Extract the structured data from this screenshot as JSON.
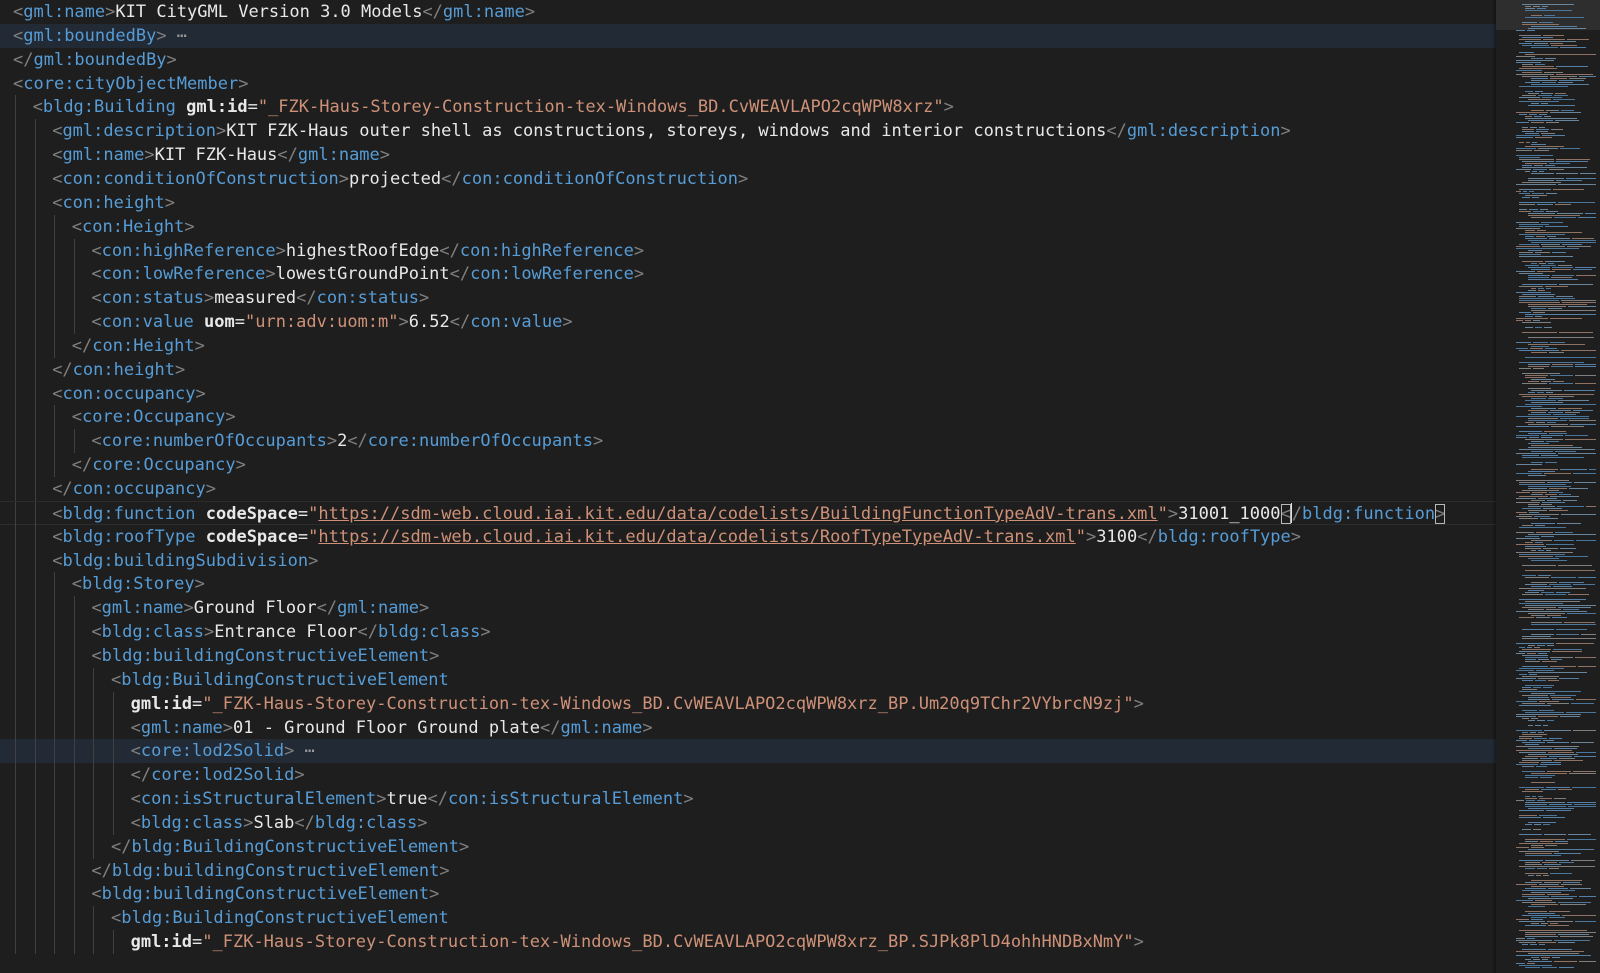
{
  "editor": {
    "language": "xml",
    "fold_ellipsis": "⋯",
    "lines": [
      {
        "indent": 0,
        "tokens": [
          [
            "b",
            "<"
          ],
          [
            "tag",
            "gml:name"
          ],
          [
            "b",
            ">"
          ],
          [
            "text",
            "KIT CityGML Version 3.0 Models"
          ],
          [
            "b",
            "</"
          ],
          [
            "tag",
            "gml:name"
          ],
          [
            "b",
            ">"
          ]
        ]
      },
      {
        "indent": 0,
        "folded": true,
        "highlight": "fold",
        "tokens": [
          [
            "b",
            "<"
          ],
          [
            "tag",
            "gml:boundedBy"
          ],
          [
            "b",
            ">"
          ]
        ]
      },
      {
        "indent": 0,
        "tokens": [
          [
            "b",
            "</"
          ],
          [
            "tag",
            "gml:boundedBy"
          ],
          [
            "b",
            ">"
          ]
        ]
      },
      {
        "indent": 0,
        "tokens": [
          [
            "b",
            "<"
          ],
          [
            "tag",
            "core:cityObjectMember"
          ],
          [
            "b",
            ">"
          ]
        ]
      },
      {
        "indent": 1,
        "tokens": [
          [
            "b",
            "<"
          ],
          [
            "tag",
            "bldg:Building"
          ],
          [
            "sp",
            " "
          ],
          [
            "attr",
            "gml:id"
          ],
          [
            "text",
            "="
          ],
          [
            "str",
            "\"_FZK-Haus-Storey-Construction-tex-Windows_BD.CvWEAVLAPO2cqWPW8xrz\""
          ],
          [
            "b",
            ">"
          ]
        ]
      },
      {
        "indent": 2,
        "tokens": [
          [
            "b",
            "<"
          ],
          [
            "tag",
            "gml:description"
          ],
          [
            "b",
            ">"
          ],
          [
            "text",
            "KIT FZK-Haus outer shell as constructions, storeys, windows and interior constructions"
          ],
          [
            "b",
            "</"
          ],
          [
            "tag",
            "gml:description"
          ],
          [
            "b",
            ">"
          ]
        ]
      },
      {
        "indent": 2,
        "tokens": [
          [
            "b",
            "<"
          ],
          [
            "tag",
            "gml:name"
          ],
          [
            "b",
            ">"
          ],
          [
            "text",
            "KIT FZK-Haus"
          ],
          [
            "b",
            "</"
          ],
          [
            "tag",
            "gml:name"
          ],
          [
            "b",
            ">"
          ]
        ]
      },
      {
        "indent": 2,
        "tokens": [
          [
            "b",
            "<"
          ],
          [
            "tag",
            "con:conditionOfConstruction"
          ],
          [
            "b",
            ">"
          ],
          [
            "text",
            "projected"
          ],
          [
            "b",
            "</"
          ],
          [
            "tag",
            "con:conditionOfConstruction"
          ],
          [
            "b",
            ">"
          ]
        ]
      },
      {
        "indent": 2,
        "tokens": [
          [
            "b",
            "<"
          ],
          [
            "tag",
            "con:height"
          ],
          [
            "b",
            ">"
          ]
        ]
      },
      {
        "indent": 3,
        "tokens": [
          [
            "b",
            "<"
          ],
          [
            "tag",
            "con:Height"
          ],
          [
            "b",
            ">"
          ]
        ]
      },
      {
        "indent": 4,
        "tokens": [
          [
            "b",
            "<"
          ],
          [
            "tag",
            "con:highReference"
          ],
          [
            "b",
            ">"
          ],
          [
            "text",
            "highestRoofEdge"
          ],
          [
            "b",
            "</"
          ],
          [
            "tag",
            "con:highReference"
          ],
          [
            "b",
            ">"
          ]
        ]
      },
      {
        "indent": 4,
        "tokens": [
          [
            "b",
            "<"
          ],
          [
            "tag",
            "con:lowReference"
          ],
          [
            "b",
            ">"
          ],
          [
            "text",
            "lowestGroundPoint"
          ],
          [
            "b",
            "</"
          ],
          [
            "tag",
            "con:lowReference"
          ],
          [
            "b",
            ">"
          ]
        ]
      },
      {
        "indent": 4,
        "tokens": [
          [
            "b",
            "<"
          ],
          [
            "tag",
            "con:status"
          ],
          [
            "b",
            ">"
          ],
          [
            "text",
            "measured"
          ],
          [
            "b",
            "</"
          ],
          [
            "tag",
            "con:status"
          ],
          [
            "b",
            ">"
          ]
        ]
      },
      {
        "indent": 4,
        "tokens": [
          [
            "b",
            "<"
          ],
          [
            "tag",
            "con:value"
          ],
          [
            "sp",
            " "
          ],
          [
            "attr",
            "uom"
          ],
          [
            "text",
            "="
          ],
          [
            "str",
            "\"urn:adv:uom:m\""
          ],
          [
            "b",
            ">"
          ],
          [
            "text",
            "6.52"
          ],
          [
            "b",
            "</"
          ],
          [
            "tag",
            "con:value"
          ],
          [
            "b",
            ">"
          ]
        ]
      },
      {
        "indent": 3,
        "tokens": [
          [
            "b",
            "</"
          ],
          [
            "tag",
            "con:Height"
          ],
          [
            "b",
            ">"
          ]
        ]
      },
      {
        "indent": 2,
        "tokens": [
          [
            "b",
            "</"
          ],
          [
            "tag",
            "con:height"
          ],
          [
            "b",
            ">"
          ]
        ]
      },
      {
        "indent": 2,
        "tokens": [
          [
            "b",
            "<"
          ],
          [
            "tag",
            "con:occupancy"
          ],
          [
            "b",
            ">"
          ]
        ]
      },
      {
        "indent": 3,
        "tokens": [
          [
            "b",
            "<"
          ],
          [
            "tag",
            "core:Occupancy"
          ],
          [
            "b",
            ">"
          ]
        ]
      },
      {
        "indent": 4,
        "tokens": [
          [
            "b",
            "<"
          ],
          [
            "tag",
            "core:numberOfOccupants"
          ],
          [
            "b",
            ">"
          ],
          [
            "text",
            "2"
          ],
          [
            "b",
            "</"
          ],
          [
            "tag",
            "core:numberOfOccupants"
          ],
          [
            "b",
            ">"
          ]
        ]
      },
      {
        "indent": 3,
        "tokens": [
          [
            "b",
            "</"
          ],
          [
            "tag",
            "core:Occupancy"
          ],
          [
            "b",
            ">"
          ]
        ]
      },
      {
        "indent": 2,
        "tokens": [
          [
            "b",
            "</"
          ],
          [
            "tag",
            "con:occupancy"
          ],
          [
            "b",
            ">"
          ]
        ]
      },
      {
        "indent": 2,
        "highlight": "cursor",
        "tokens": [
          [
            "b",
            "<"
          ],
          [
            "tag",
            "bldg:function"
          ],
          [
            "sp",
            " "
          ],
          [
            "attr",
            "codeSpace"
          ],
          [
            "text",
            "="
          ],
          [
            "str",
            "\""
          ],
          [
            "url",
            "https://sdm-web.cloud.iai.kit.edu/data/codelists/BuildingFunctionTypeAdV-trans.xml"
          ],
          [
            "str",
            "\""
          ],
          [
            "b",
            ">"
          ],
          [
            "text",
            "31001_1000"
          ],
          [
            "bbox",
            "<"
          ],
          [
            "cursor",
            ""
          ],
          [
            "b",
            "/"
          ],
          [
            "tag",
            "bldg:function"
          ],
          [
            "bbox",
            ">"
          ]
        ]
      },
      {
        "indent": 2,
        "tokens": [
          [
            "b",
            "<"
          ],
          [
            "tag",
            "bldg:roofType"
          ],
          [
            "sp",
            " "
          ],
          [
            "attr",
            "codeSpace"
          ],
          [
            "text",
            "="
          ],
          [
            "str",
            "\""
          ],
          [
            "url",
            "https://sdm-web.cloud.iai.kit.edu/data/codelists/RoofTypeTypeAdV-trans.xml"
          ],
          [
            "str",
            "\""
          ],
          [
            "b",
            ">"
          ],
          [
            "text",
            "3100"
          ],
          [
            "b",
            "</"
          ],
          [
            "tag",
            "bldg:roofType"
          ],
          [
            "b",
            ">"
          ]
        ]
      },
      {
        "indent": 2,
        "tokens": [
          [
            "b",
            "<"
          ],
          [
            "tag",
            "bldg:buildingSubdivision"
          ],
          [
            "b",
            ">"
          ]
        ]
      },
      {
        "indent": 3,
        "tokens": [
          [
            "b",
            "<"
          ],
          [
            "tag",
            "bldg:Storey"
          ],
          [
            "b",
            ">"
          ]
        ]
      },
      {
        "indent": 4,
        "tokens": [
          [
            "b",
            "<"
          ],
          [
            "tag",
            "gml:name"
          ],
          [
            "b",
            ">"
          ],
          [
            "text",
            "Ground Floor"
          ],
          [
            "b",
            "</"
          ],
          [
            "tag",
            "gml:name"
          ],
          [
            "b",
            ">"
          ]
        ]
      },
      {
        "indent": 4,
        "tokens": [
          [
            "b",
            "<"
          ],
          [
            "tag",
            "bldg:class"
          ],
          [
            "b",
            ">"
          ],
          [
            "text",
            "Entrance Floor"
          ],
          [
            "b",
            "</"
          ],
          [
            "tag",
            "bldg:class"
          ],
          [
            "b",
            ">"
          ]
        ]
      },
      {
        "indent": 4,
        "tokens": [
          [
            "b",
            "<"
          ],
          [
            "tag",
            "bldg:buildingConstructiveElement"
          ],
          [
            "b",
            ">"
          ]
        ]
      },
      {
        "indent": 5,
        "tokens": [
          [
            "b",
            "<"
          ],
          [
            "tag",
            "bldg:BuildingConstructiveElement"
          ]
        ]
      },
      {
        "indent": 6,
        "tokens": [
          [
            "attr",
            "gml:id"
          ],
          [
            "text",
            "="
          ],
          [
            "str",
            "\"_FZK-Haus-Storey-Construction-tex-Windows_BD.CvWEAVLAPO2cqWPW8xrz_BP.Um20q9TChr2VYbrcN9zj\""
          ],
          [
            "b",
            ">"
          ]
        ]
      },
      {
        "indent": 6,
        "tokens": [
          [
            "b",
            "<"
          ],
          [
            "tag",
            "gml:name"
          ],
          [
            "b",
            ">"
          ],
          [
            "text",
            "01 - Ground Floor Ground plate"
          ],
          [
            "b",
            "</"
          ],
          [
            "tag",
            "gml:name"
          ],
          [
            "b",
            ">"
          ]
        ]
      },
      {
        "indent": 6,
        "folded": true,
        "highlight": "fold",
        "tokens": [
          [
            "b",
            "<"
          ],
          [
            "tag",
            "core:lod2Solid"
          ],
          [
            "b",
            ">"
          ]
        ]
      },
      {
        "indent": 6,
        "tokens": [
          [
            "b",
            "</"
          ],
          [
            "tag",
            "core:lod2Solid"
          ],
          [
            "b",
            ">"
          ]
        ]
      },
      {
        "indent": 6,
        "tokens": [
          [
            "b",
            "<"
          ],
          [
            "tag",
            "con:isStructuralElement"
          ],
          [
            "b",
            ">"
          ],
          [
            "text",
            "true"
          ],
          [
            "b",
            "</"
          ],
          [
            "tag",
            "con:isStructuralElement"
          ],
          [
            "b",
            ">"
          ]
        ]
      },
      {
        "indent": 6,
        "tokens": [
          [
            "b",
            "<"
          ],
          [
            "tag",
            "bldg:class"
          ],
          [
            "b",
            ">"
          ],
          [
            "text",
            "Slab"
          ],
          [
            "b",
            "</"
          ],
          [
            "tag",
            "bldg:class"
          ],
          [
            "b",
            ">"
          ]
        ]
      },
      {
        "indent": 5,
        "tokens": [
          [
            "b",
            "</"
          ],
          [
            "tag",
            "bldg:BuildingConstructiveElement"
          ],
          [
            "b",
            ">"
          ]
        ]
      },
      {
        "indent": 4,
        "tokens": [
          [
            "b",
            "</"
          ],
          [
            "tag",
            "bldg:buildingConstructiveElement"
          ],
          [
            "b",
            ">"
          ]
        ]
      },
      {
        "indent": 4,
        "tokens": [
          [
            "b",
            "<"
          ],
          [
            "tag",
            "bldg:buildingConstructiveElement"
          ],
          [
            "b",
            ">"
          ]
        ]
      },
      {
        "indent": 5,
        "tokens": [
          [
            "b",
            "<"
          ],
          [
            "tag",
            "bldg:BuildingConstructiveElement"
          ]
        ]
      },
      {
        "indent": 6,
        "tokens": [
          [
            "attr",
            "gml:id"
          ],
          [
            "text",
            "="
          ],
          [
            "str",
            "\"_FZK-Haus-Storey-Construction-tex-Windows_BD.CvWEAVLAPO2cqWPW8xrz_BP.SJPk8PlD4ohhHNDBxNmY\""
          ],
          [
            "b",
            ">"
          ]
        ]
      }
    ]
  },
  "colors": {
    "background": "#1e1e1e",
    "tag": "#569cd6",
    "bracket": "#808080",
    "attribute": "#e8e8e8",
    "string": "#ce9178",
    "text": "#e8e8e8"
  }
}
